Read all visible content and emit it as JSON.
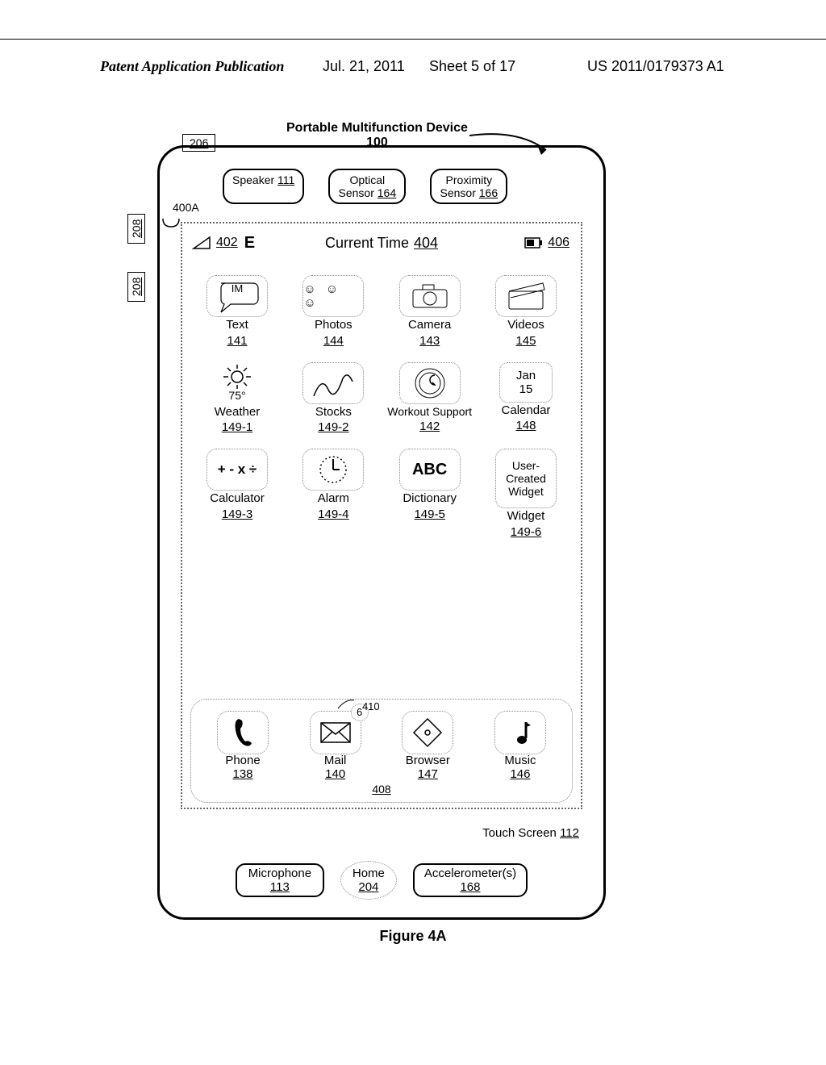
{
  "header": {
    "left": "Patent Application Publication",
    "date": "Jul. 21, 2011",
    "sheet": "Sheet 5 of 17",
    "right": "US 2011/0179373 A1"
  },
  "title": {
    "line1": "Portable Multifunction Device",
    "ref": "100"
  },
  "ref206": "206",
  "ref208": "208",
  "ref400A": "400A",
  "sensors": {
    "speaker_label": "Speaker",
    "speaker_ref": "111",
    "optical_label1": "Optical",
    "optical_label2": "Sensor",
    "optical_ref": "164",
    "prox_label1": "Proximity",
    "prox_label2": "Sensor",
    "prox_ref": "166"
  },
  "statusbar": {
    "sig_ref": "402",
    "carrier": "E",
    "time_label": "Current Time",
    "time_ref": "404",
    "batt_ref": "406"
  },
  "apps_row1": [
    {
      "name": "text",
      "icon": "im-bubble",
      "icontext": "IM",
      "label": "Text",
      "ref": "141"
    },
    {
      "name": "photos",
      "icon": "photos",
      "label": "Photos",
      "ref": "144"
    },
    {
      "name": "camera",
      "icon": "camera",
      "label": "Camera",
      "ref": "143"
    },
    {
      "name": "videos",
      "icon": "videos",
      "label": "Videos",
      "ref": "145"
    }
  ],
  "apps_row2": [
    {
      "name": "weather",
      "icon": "sun",
      "icontext": "75°",
      "label": "Weather",
      "ref": "149-1"
    },
    {
      "name": "stocks",
      "icon": "stocks",
      "label": "Stocks",
      "ref": "149-2"
    },
    {
      "name": "workout",
      "icon": "workout",
      "label": "Workout Support",
      "ref": "142"
    },
    {
      "name": "calendar",
      "icon": "calbox",
      "cal_month": "Jan",
      "cal_day": "15",
      "label": "Calendar",
      "ref": "148"
    }
  ],
  "apps_row3": [
    {
      "name": "calculator",
      "icon": "calc",
      "icontext": "+ - x ÷",
      "label": "Calculator",
      "ref": "149-3"
    },
    {
      "name": "alarm",
      "icon": "clock",
      "label": "Alarm",
      "ref": "149-4"
    },
    {
      "name": "dictionary",
      "icon": "abc",
      "icontext": "ABC",
      "label": "Dictionary",
      "ref": "149-5"
    },
    {
      "name": "user-widget",
      "icon": "textbox",
      "icontext": "User-\nCreated\nWidget",
      "label": "Widget",
      "ref": "149-6"
    }
  ],
  "dock": {
    "ref410": "410",
    "ref408": "408",
    "items": [
      {
        "name": "phone",
        "icon": "phone",
        "label": "Phone",
        "ref": "138"
      },
      {
        "name": "mail",
        "icon": "mail",
        "badge": "6",
        "label": "Mail",
        "ref": "140"
      },
      {
        "name": "browser",
        "icon": "compass",
        "label": "Browser",
        "ref": "147"
      },
      {
        "name": "music",
        "icon": "music",
        "label": "Music",
        "ref": "146"
      }
    ]
  },
  "touch_screen": {
    "label": "Touch Screen",
    "ref": "112"
  },
  "bottom": {
    "mic_label": "Microphone",
    "mic_ref": "113",
    "home_label": "Home",
    "home_ref": "204",
    "accel_label": "Accelerometer(s)",
    "accel_ref": "168"
  },
  "figure": "Figure 4A"
}
